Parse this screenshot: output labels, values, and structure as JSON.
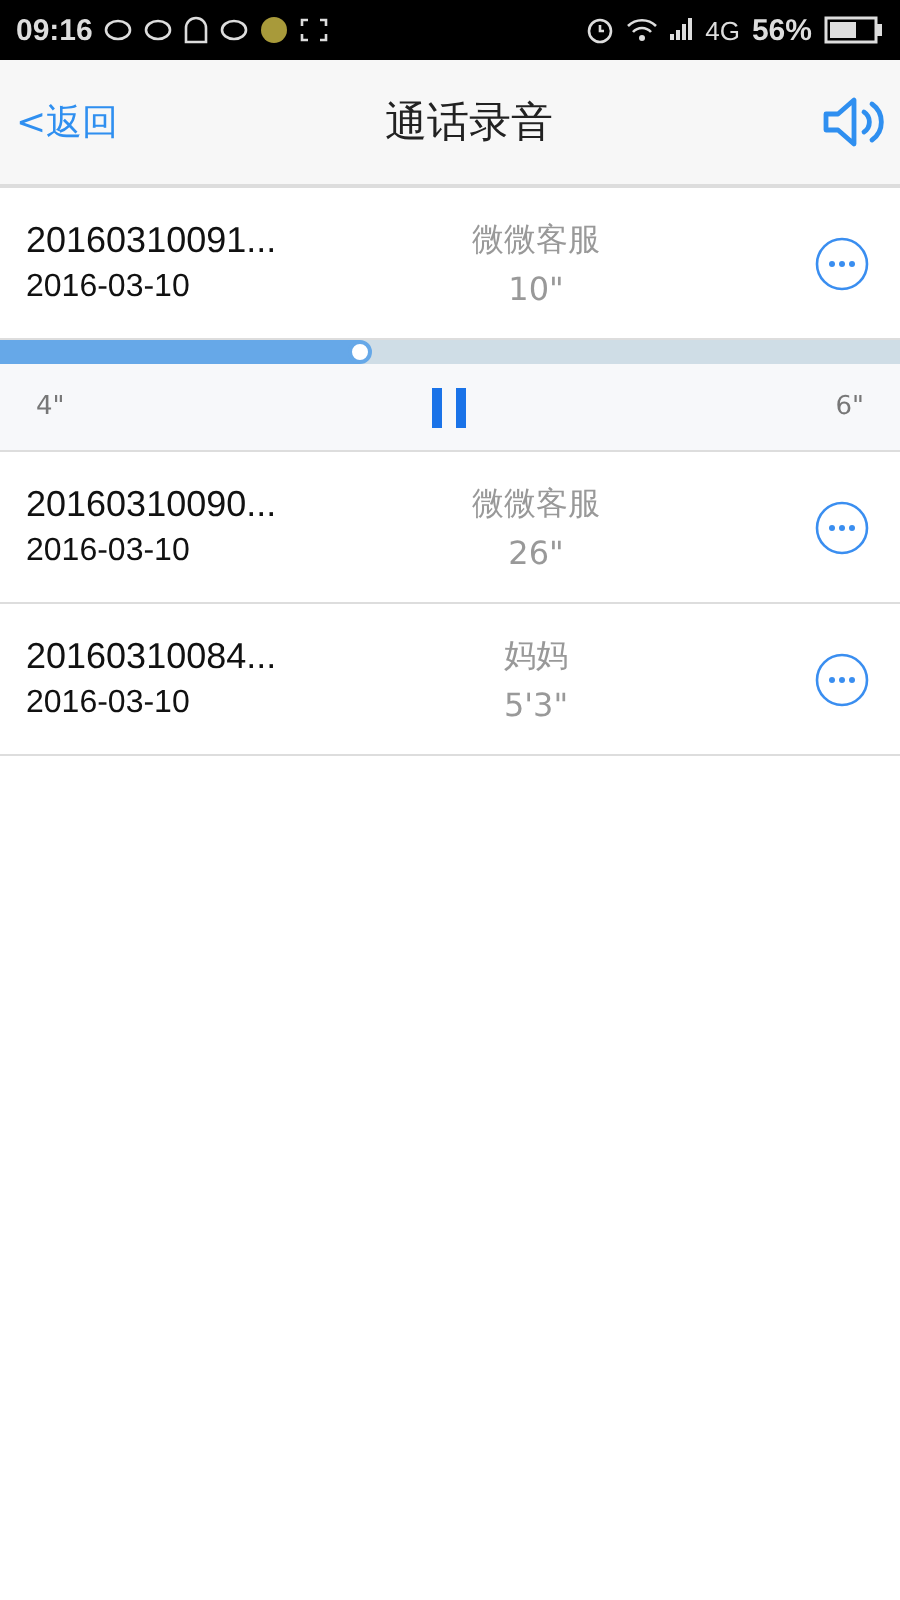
{
  "status_bar": {
    "time": "09:16",
    "network": "4G",
    "battery": "56%"
  },
  "nav": {
    "back": "<返回",
    "title": "通话录音"
  },
  "recordings": [
    {
      "name": "20160310091...",
      "date": "2016-03-10",
      "contact": "微微客服",
      "duration": "10\"",
      "player": {
        "level": 0.4,
        "elapsed": "4\"",
        "remaining": "6\"",
        "playing": true
      }
    },
    {
      "name": "20160310090...",
      "date": "2016-03-10",
      "contact": "微微客服",
      "duration": "26\""
    },
    {
      "name": "20160310084...",
      "date": "2016-03-10",
      "contact": "妈妈",
      "duration": "5'3\""
    }
  ]
}
